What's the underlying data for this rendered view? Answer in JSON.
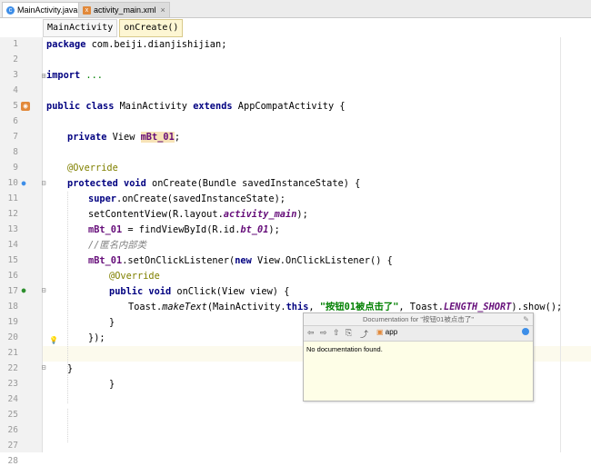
{
  "tabs": [
    {
      "label": "MainActivity.java",
      "icon": "class-icon",
      "active": true
    },
    {
      "label": "activity_main.xml",
      "icon": "xml-file-icon",
      "active": false
    }
  ],
  "breadcrumbs": [
    "MainActivity",
    "onCreate()"
  ],
  "line_numbers": [
    "1",
    "2",
    "3",
    "4",
    "5",
    "6",
    "7",
    "8",
    "9",
    "10",
    "11",
    "12",
    "13",
    "14",
    "15",
    "16",
    "17",
    "18",
    "19",
    "20",
    "21",
    "22",
    "23",
    "24",
    "25",
    "26",
    "27",
    "28"
  ],
  "code": {
    "l1_kw": "package",
    "l1_rest": " com.beiji.dianjishijian;",
    "l3_kw": "import",
    "l3_fold": " ...",
    "l5_kw1": "public class",
    "l5_name": " MainActivity ",
    "l5_kw2": "extends",
    "l5_rest": " AppCompatActivity {",
    "l7_kw": "private",
    "l7_type": " View ",
    "l7_field": "mBt_01",
    "l7_end": ";",
    "l9_ann": "@Override",
    "l10_kw": "protected void",
    "l10_rest": " onCreate(Bundle savedInstanceState) {",
    "l11_kw": "super",
    "l11_rest": ".onCreate(savedInstanceState);",
    "l12_a": "setContentView(R.layout.",
    "l12_field": "activity_main",
    "l12_end": ");",
    "l13_field": "mBt_01",
    "l13_a": " = findViewById(R.id.",
    "l13_id": "bt_01",
    "l13_end": ");",
    "l14_comment": "//匿名内部类",
    "l15_field": "mBt_01",
    "l15_a": ".setOnClickListener(",
    "l15_kw": "new",
    "l15_rest": " View.OnClickListener() {",
    "l16_ann": "@Override",
    "l17_kw": "public void",
    "l17_rest": " onClick(View view) {",
    "l18_a": "Toast.",
    "l18_method": "makeText",
    "l18_b": "(MainActivity.",
    "l18_kw": "this",
    "l18_c": ", ",
    "l18_str": "\"按钮01被点击了\"",
    "l18_d": ", Toast.",
    "l18_const": "LENGTH_SHORT",
    "l18_e": ").show();",
    "l19": "}",
    "l20": "});",
    "l22": "}",
    "l23": "}"
  },
  "doc_popup": {
    "title": "Documentation for \"按钮01被点击了\"",
    "module": "app",
    "body": "No documentation found."
  },
  "colors": {
    "keyword": "#000080",
    "annotation": "#808000",
    "field": "#660e7a",
    "string": "#008000",
    "comment": "#808080"
  }
}
